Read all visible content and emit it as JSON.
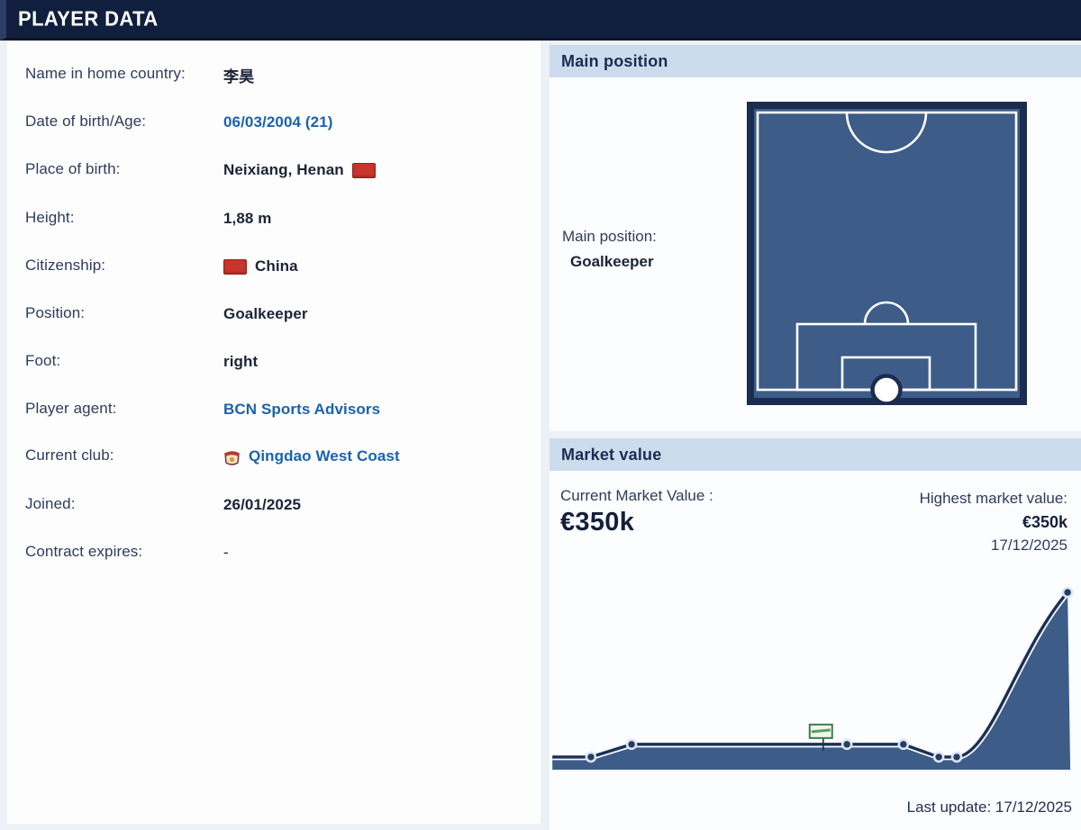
{
  "header": {
    "title": "PLAYER DATA"
  },
  "player_info": {
    "rows": [
      {
        "label": "Name in home country:",
        "value": "李昊"
      },
      {
        "label": "Date of birth/Age:",
        "value": "06/03/2004 (21)"
      },
      {
        "label": "Place of birth:",
        "value": "Neixiang, Henan",
        "flag": "china-flag"
      },
      {
        "label": "Height:",
        "value": "1,88 m"
      },
      {
        "label": "Citizenship:",
        "value": "China",
        "flag": "china-flag"
      },
      {
        "label": "Position:",
        "value": "Goalkeeper"
      },
      {
        "label": "Foot:",
        "value": "right"
      },
      {
        "label": "Player agent:",
        "value": "BCN Sports Advisors"
      },
      {
        "label": "Current club:",
        "value": "Qingdao West Coast",
        "icon": "club-crest"
      },
      {
        "label": "Joined:",
        "value": "26/01/2025"
      },
      {
        "label": "Contract expires:",
        "value": "-"
      }
    ]
  },
  "main_position": {
    "section_title": "Main position",
    "label": "Main position:",
    "value": "Goalkeeper",
    "marker": "goalkeeper-position-on-pitch"
  },
  "market_value": {
    "section_title": "Market value",
    "current_label": "Current Market Value :",
    "current_value": "€350k",
    "highest_label": "Highest market value:",
    "highest_value": "€350k",
    "highest_date": "17/12/2025",
    "last_update": "Last update: 17/12/2025"
  },
  "chart_data": {
    "type": "area",
    "title": "Market value history",
    "unit": "EUR thousands (values estimated from line heights; x-axis unlabeled)",
    "ylim": [
      0,
      350
    ],
    "x_labels_visible": false,
    "grid": false,
    "legend": false,
    "series": [
      {
        "name": "Market value",
        "x_frac": [
          0.002,
          0.075,
          0.152,
          0.56,
          0.667,
          0.734,
          0.768,
          0.978
        ],
        "values": [
          25,
          25,
          50,
          50,
          50,
          25,
          25,
          350
        ]
      }
    ],
    "peak": {
      "value": "€350k",
      "date": "17/12/2025"
    },
    "transfer_marker": {
      "x_frac": 0.515,
      "note": "small green club-transfer badge on the curve"
    }
  },
  "colors": {
    "topbar_navy": "#101f3e",
    "section_header_bg": "#ccdcec",
    "section_header_text": "#1c2c52",
    "link_blue": "#1a62ad",
    "flag_red": "#c8352c",
    "pitch_fill": "#3d5c88",
    "pitch_border": "#1b2c50",
    "chart_line": "#1b2f54",
    "chart_fill": "#3d5c88",
    "chart_dot": "#263c63",
    "chart_dot_ring": "#dce7f3",
    "badge_green": "#3f7d49"
  }
}
